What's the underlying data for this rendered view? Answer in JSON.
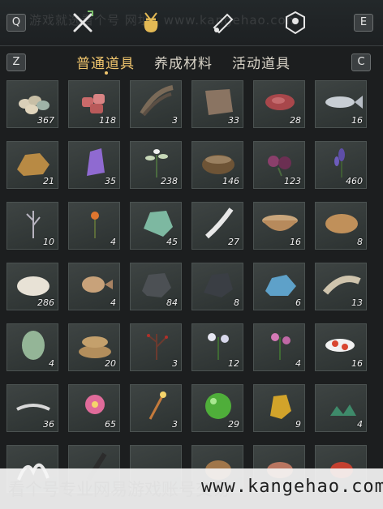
{
  "topbar": {
    "key_left": "Q",
    "key_right": "E",
    "watermark": "游戏就选看个号 网址：www.kangehao.com",
    "icons": [
      "tree-icon",
      "crossed-swords-icon",
      "pouch-icon",
      "scroll-icon",
      "map-marker-icon"
    ]
  },
  "tabs": {
    "key_left": "Z",
    "key_right": "C",
    "items": [
      {
        "label": "普通道具",
        "active": true
      },
      {
        "label": "养成材料",
        "active": false
      },
      {
        "label": "活动道具",
        "active": false
      }
    ]
  },
  "inventory": [
    {
      "name": "eggs",
      "count": "367"
    },
    {
      "name": "raw-meat",
      "count": "118"
    },
    {
      "name": "feathers",
      "count": "3"
    },
    {
      "name": "hide",
      "count": "33"
    },
    {
      "name": "steak",
      "count": "28"
    },
    {
      "name": "fish",
      "count": "16"
    },
    {
      "name": "ore-nugget",
      "count": "21"
    },
    {
      "name": "amethyst",
      "count": "35"
    },
    {
      "name": "white-herb",
      "count": "238"
    },
    {
      "name": "mortar-bowl",
      "count": "146"
    },
    {
      "name": "purple-flower",
      "count": "123"
    },
    {
      "name": "lavender",
      "count": "460"
    },
    {
      "name": "dried-twig",
      "count": "10"
    },
    {
      "name": "orange-flower",
      "count": "4"
    },
    {
      "name": "jade-stone",
      "count": "45"
    },
    {
      "name": "white-feather",
      "count": "27"
    },
    {
      "name": "soup-bowl",
      "count": "16"
    },
    {
      "name": "bread",
      "count": "8"
    },
    {
      "name": "wool",
      "count": "286"
    },
    {
      "name": "pufferfish",
      "count": "4"
    },
    {
      "name": "iron-ore",
      "count": "84"
    },
    {
      "name": "dark-stone",
      "count": "8"
    },
    {
      "name": "blue-crystal",
      "count": "6"
    },
    {
      "name": "bone",
      "count": "13"
    },
    {
      "name": "melon",
      "count": "4"
    },
    {
      "name": "grain-sacks",
      "count": "20"
    },
    {
      "name": "red-berries",
      "count": "3"
    },
    {
      "name": "white-flowers",
      "count": "12"
    },
    {
      "name": "pink-flowers",
      "count": "4"
    },
    {
      "name": "koi-fish",
      "count": "16"
    },
    {
      "name": "shrimp",
      "count": "36"
    },
    {
      "name": "pink-blossom",
      "count": "65"
    },
    {
      "name": "firecracker",
      "count": "3"
    },
    {
      "name": "green-orb",
      "count": "29"
    },
    {
      "name": "gold-nugget",
      "count": "9"
    },
    {
      "name": "green-crystals",
      "count": "4"
    },
    {
      "name": "white-coral",
      "count": ""
    },
    {
      "name": "dark-feather",
      "count": ""
    },
    {
      "name": "empty",
      "count": ""
    },
    {
      "name": "clay-pot",
      "count": ""
    },
    {
      "name": "meat-piece",
      "count": ""
    },
    {
      "name": "red-item",
      "count": ""
    }
  ],
  "banner": {
    "text": "看个号专业网易游戏账号交易",
    "url": "www.kangehao.com"
  },
  "colors": {
    "accent": "#f0c56d",
    "background": "#1c1e1f",
    "cell": "#353b3a"
  }
}
